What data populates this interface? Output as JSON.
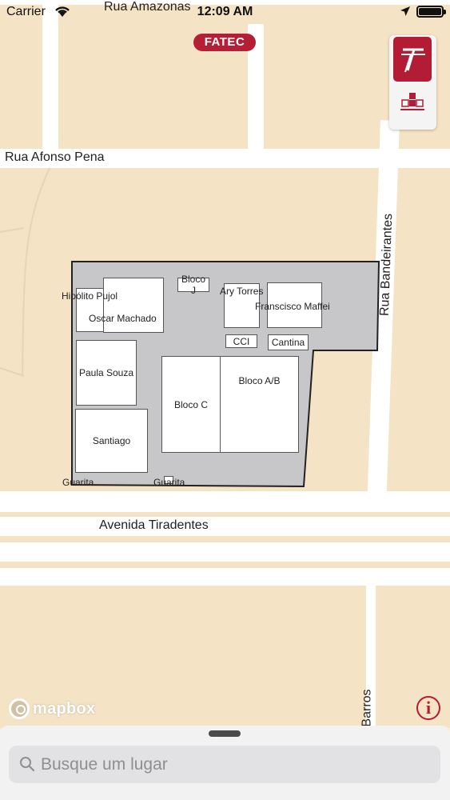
{
  "status_bar": {
    "carrier": "Carrier",
    "time": "12:09 AM",
    "icons": [
      "wifi-icon",
      "location-arrow-icon",
      "battery-icon"
    ]
  },
  "map": {
    "badge": "FATEC",
    "roads": {
      "rua_amazonas": "Rua Amazonas",
      "rua_afonso_pena": "Rua Afonso Pena",
      "rua_bandeirantes": "Rua Bandeirantes",
      "avenida_tiradentes": "Avenida Tiradentes",
      "barros": "Barros"
    },
    "buildings": {
      "hipolito_pujol": "Hipólito Pujol",
      "oscar_machado": "Oscar Machado",
      "bloco_j": "Bloco J",
      "ary_torres": "Ary Torres",
      "francisco_maffei": "Franscisco Maffei",
      "cci": "CCI",
      "cantina": "Cantina",
      "paula_souza": "Paula Souza",
      "bloco_c": "Bloco C",
      "bloco_ab": "Bloco A/B",
      "santiago": "Santiago",
      "guarita_1": "Guarita",
      "guarita_2": "Guarita"
    },
    "attribution": "mapbox",
    "info_label": "i"
  },
  "search": {
    "placeholder": "Busque um lugar"
  },
  "colors": {
    "brand": "#b31c35",
    "map_bg": "#f4e3c4",
    "campus_fill": "#c7c7c9",
    "road": "#ffffff"
  }
}
